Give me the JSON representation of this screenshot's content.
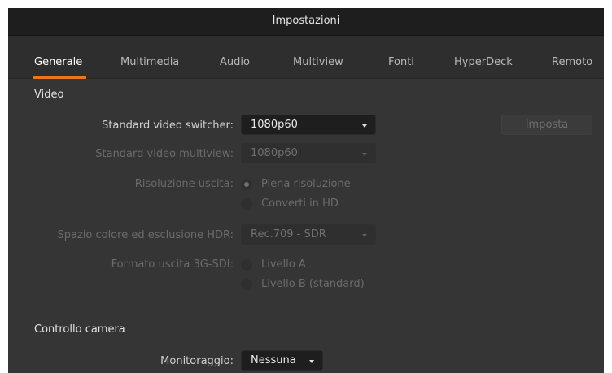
{
  "window": {
    "title": "Impostazioni"
  },
  "tabs": [
    {
      "label": "Generale",
      "active": true
    },
    {
      "label": "Multimedia",
      "active": false
    },
    {
      "label": "Audio",
      "active": false
    },
    {
      "label": "Multiview",
      "active": false
    },
    {
      "label": "Fonti",
      "active": false
    },
    {
      "label": "HyperDeck",
      "active": false
    },
    {
      "label": "Remoto",
      "active": false
    }
  ],
  "video": {
    "section_title": "Video",
    "switcher_standard": {
      "label": "Standard video switcher:",
      "value": "1080p60"
    },
    "set_button": "Imposta",
    "multiview_standard": {
      "label": "Standard video multiview:",
      "value": "1080p60"
    },
    "output_resolution": {
      "label": "Risoluzione uscita:",
      "options": [
        "Piena risoluzione",
        "Converti in HD"
      ],
      "selected": "Piena risoluzione"
    },
    "hdr": {
      "label": "Spazio colore ed esclusione HDR:",
      "value": "Rec.709 - SDR"
    },
    "sdi_format": {
      "label": "Formato uscita 3G-SDI:",
      "options": [
        "Livello A",
        "Livello B (standard)"
      ]
    }
  },
  "camera_control": {
    "section_title": "Controllo camera",
    "monitoring": {
      "label": "Monitoraggio:",
      "value": "Nessuna"
    }
  },
  "colors": {
    "accent": "#e8761e",
    "panel": "#353535",
    "titlebar": "#1e1e1e"
  }
}
